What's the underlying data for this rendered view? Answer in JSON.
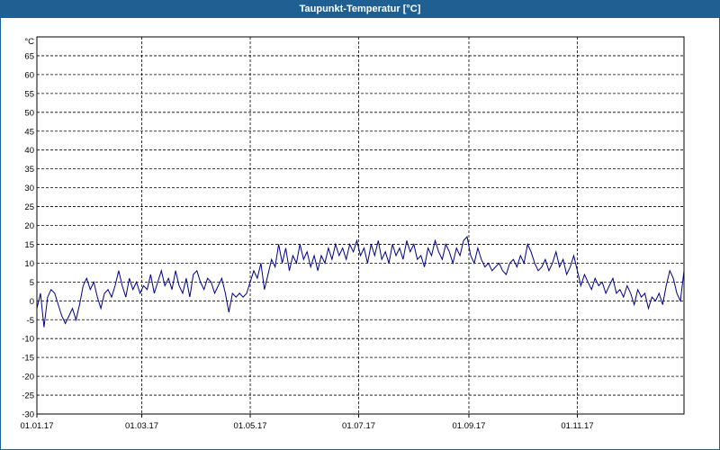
{
  "window": {
    "title": "Taupunkt-Temperatur [°C]"
  },
  "chart_data": {
    "type": "line",
    "title": "Taupunkt-Temperatur [°C]",
    "ylabel": "°C",
    "xlabel": "",
    "ylim": [
      -30,
      70
    ],
    "xlim": [
      "2017-01-01",
      "2017-12-31"
    ],
    "grid": true,
    "y_ticks": [
      65,
      60,
      55,
      50,
      45,
      40,
      35,
      30,
      25,
      20,
      15,
      10,
      5,
      0,
      -5,
      -10,
      -15,
      -20,
      -25,
      -30
    ],
    "x_ticks": [
      {
        "label": "01.01.17",
        "date": "2017-01-01"
      },
      {
        "label": "01.03.17",
        "date": "2017-03-01"
      },
      {
        "label": "01.05.17",
        "date": "2017-05-01"
      },
      {
        "label": "01.07.17",
        "date": "2017-07-01"
      },
      {
        "label": "01.09.17",
        "date": "2017-09-01"
      },
      {
        "label": "01.11.17",
        "date": "2017-11-01"
      }
    ],
    "series_color": "#00008b",
    "series": [
      {
        "values": [
          [
            "2017-01-01",
            -2
          ],
          [
            "2017-01-03",
            2
          ],
          [
            "2017-01-05",
            -7
          ],
          [
            "2017-01-07",
            1
          ],
          [
            "2017-01-09",
            3
          ],
          [
            "2017-01-11",
            2
          ],
          [
            "2017-01-13",
            -1
          ],
          [
            "2017-01-15",
            -4
          ],
          [
            "2017-01-17",
            -6
          ],
          [
            "2017-01-19",
            -4
          ],
          [
            "2017-01-21",
            -2
          ],
          [
            "2017-01-23",
            -5
          ],
          [
            "2017-01-25",
            -1
          ],
          [
            "2017-01-27",
            4
          ],
          [
            "2017-01-29",
            6
          ],
          [
            "2017-01-31",
            3
          ],
          [
            "2017-02-02",
            5
          ],
          [
            "2017-02-04",
            1
          ],
          [
            "2017-02-06",
            -2
          ],
          [
            "2017-02-08",
            2
          ],
          [
            "2017-02-10",
            3
          ],
          [
            "2017-02-12",
            1
          ],
          [
            "2017-02-14",
            4
          ],
          [
            "2017-02-16",
            8
          ],
          [
            "2017-02-18",
            4
          ],
          [
            "2017-02-20",
            1
          ],
          [
            "2017-02-22",
            6
          ],
          [
            "2017-02-24",
            3
          ],
          [
            "2017-02-26",
            5
          ],
          [
            "2017-02-28",
            2
          ],
          [
            "2017-03-02",
            4
          ],
          [
            "2017-03-04",
            3
          ],
          [
            "2017-03-06",
            7
          ],
          [
            "2017-03-08",
            2
          ],
          [
            "2017-03-10",
            5
          ],
          [
            "2017-03-12",
            8
          ],
          [
            "2017-03-14",
            4
          ],
          [
            "2017-03-16",
            6
          ],
          [
            "2017-03-18",
            3
          ],
          [
            "2017-03-20",
            8
          ],
          [
            "2017-03-22",
            4
          ],
          [
            "2017-03-24",
            2
          ],
          [
            "2017-03-26",
            6
          ],
          [
            "2017-03-28",
            1
          ],
          [
            "2017-03-30",
            7
          ],
          [
            "2017-04-01",
            8
          ],
          [
            "2017-04-03",
            5
          ],
          [
            "2017-04-05",
            3
          ],
          [
            "2017-04-07",
            6
          ],
          [
            "2017-04-09",
            5
          ],
          [
            "2017-04-11",
            2
          ],
          [
            "2017-04-13",
            4
          ],
          [
            "2017-04-15",
            6
          ],
          [
            "2017-04-17",
            2
          ],
          [
            "2017-04-19",
            -3
          ],
          [
            "2017-04-21",
            2
          ],
          [
            "2017-04-23",
            1
          ],
          [
            "2017-04-25",
            2
          ],
          [
            "2017-04-27",
            1
          ],
          [
            "2017-04-29",
            2
          ],
          [
            "2017-05-01",
            5
          ],
          [
            "2017-05-03",
            8
          ],
          [
            "2017-05-05",
            6
          ],
          [
            "2017-05-07",
            10
          ],
          [
            "2017-05-09",
            3
          ],
          [
            "2017-05-11",
            7
          ],
          [
            "2017-05-13",
            11
          ],
          [
            "2017-05-15",
            9
          ],
          [
            "2017-05-17",
            15
          ],
          [
            "2017-05-19",
            10
          ],
          [
            "2017-05-21",
            14
          ],
          [
            "2017-05-23",
            8
          ],
          [
            "2017-05-25",
            12
          ],
          [
            "2017-05-27",
            10
          ],
          [
            "2017-05-29",
            15
          ],
          [
            "2017-05-31",
            11
          ],
          [
            "2017-06-02",
            13
          ],
          [
            "2017-06-04",
            9
          ],
          [
            "2017-06-06",
            12
          ],
          [
            "2017-06-08",
            8
          ],
          [
            "2017-06-10",
            12
          ],
          [
            "2017-06-12",
            10
          ],
          [
            "2017-06-14",
            14
          ],
          [
            "2017-06-16",
            11
          ],
          [
            "2017-06-18",
            15
          ],
          [
            "2017-06-20",
            12
          ],
          [
            "2017-06-22",
            14
          ],
          [
            "2017-06-24",
            11
          ],
          [
            "2017-06-26",
            15
          ],
          [
            "2017-06-28",
            13
          ],
          [
            "2017-06-30",
            16
          ],
          [
            "2017-07-02",
            12
          ],
          [
            "2017-07-04",
            14
          ],
          [
            "2017-07-06",
            10
          ],
          [
            "2017-07-08",
            15
          ],
          [
            "2017-07-10",
            12
          ],
          [
            "2017-07-12",
            16
          ],
          [
            "2017-07-14",
            11
          ],
          [
            "2017-07-16",
            13
          ],
          [
            "2017-07-18",
            10
          ],
          [
            "2017-07-20",
            15
          ],
          [
            "2017-07-22",
            12
          ],
          [
            "2017-07-24",
            14
          ],
          [
            "2017-07-26",
            11
          ],
          [
            "2017-07-28",
            16
          ],
          [
            "2017-07-30",
            13
          ],
          [
            "2017-08-01",
            15
          ],
          [
            "2017-08-03",
            11
          ],
          [
            "2017-08-05",
            12
          ],
          [
            "2017-08-07",
            9
          ],
          [
            "2017-08-09",
            14
          ],
          [
            "2017-08-11",
            12
          ],
          [
            "2017-08-13",
            16
          ],
          [
            "2017-08-15",
            13
          ],
          [
            "2017-08-17",
            11
          ],
          [
            "2017-08-19",
            15
          ],
          [
            "2017-08-21",
            13
          ],
          [
            "2017-08-23",
            10
          ],
          [
            "2017-08-25",
            14
          ],
          [
            "2017-08-27",
            12
          ],
          [
            "2017-08-29",
            16
          ],
          [
            "2017-08-31",
            17
          ],
          [
            "2017-09-02",
            12
          ],
          [
            "2017-09-04",
            10
          ],
          [
            "2017-09-06",
            14
          ],
          [
            "2017-09-08",
            11
          ],
          [
            "2017-09-10",
            9
          ],
          [
            "2017-09-12",
            10
          ],
          [
            "2017-09-14",
            8
          ],
          [
            "2017-09-16",
            9
          ],
          [
            "2017-09-18",
            10
          ],
          [
            "2017-09-20",
            8
          ],
          [
            "2017-09-22",
            7
          ],
          [
            "2017-09-24",
            10
          ],
          [
            "2017-09-26",
            11
          ],
          [
            "2017-09-28",
            9
          ],
          [
            "2017-09-30",
            12
          ],
          [
            "2017-10-02",
            10
          ],
          [
            "2017-10-04",
            15
          ],
          [
            "2017-10-06",
            13
          ],
          [
            "2017-10-08",
            10
          ],
          [
            "2017-10-10",
            8
          ],
          [
            "2017-10-12",
            9
          ],
          [
            "2017-10-14",
            11
          ],
          [
            "2017-10-16",
            8
          ],
          [
            "2017-10-18",
            10
          ],
          [
            "2017-10-20",
            13
          ],
          [
            "2017-10-22",
            9
          ],
          [
            "2017-10-24",
            11
          ],
          [
            "2017-10-26",
            7
          ],
          [
            "2017-10-28",
            9
          ],
          [
            "2017-10-30",
            12
          ],
          [
            "2017-11-01",
            8
          ],
          [
            "2017-11-03",
            4
          ],
          [
            "2017-11-05",
            7
          ],
          [
            "2017-11-07",
            5
          ],
          [
            "2017-11-09",
            3
          ],
          [
            "2017-11-11",
            6
          ],
          [
            "2017-11-13",
            4
          ],
          [
            "2017-11-15",
            5
          ],
          [
            "2017-11-17",
            2
          ],
          [
            "2017-11-19",
            4
          ],
          [
            "2017-11-21",
            6
          ],
          [
            "2017-11-23",
            2
          ],
          [
            "2017-11-25",
            3
          ],
          [
            "2017-11-27",
            1
          ],
          [
            "2017-11-29",
            4
          ],
          [
            "2017-12-01",
            2
          ],
          [
            "2017-12-03",
            -1
          ],
          [
            "2017-12-05",
            3
          ],
          [
            "2017-12-07",
            1
          ],
          [
            "2017-12-09",
            2
          ],
          [
            "2017-12-11",
            -2
          ],
          [
            "2017-12-13",
            1
          ],
          [
            "2017-12-15",
            0
          ],
          [
            "2017-12-17",
            2
          ],
          [
            "2017-12-19",
            -1
          ],
          [
            "2017-12-21",
            4
          ],
          [
            "2017-12-23",
            8
          ],
          [
            "2017-12-25",
            6
          ],
          [
            "2017-12-27",
            2
          ],
          [
            "2017-12-29",
            0
          ],
          [
            "2017-12-31",
            8
          ]
        ]
      }
    ]
  }
}
